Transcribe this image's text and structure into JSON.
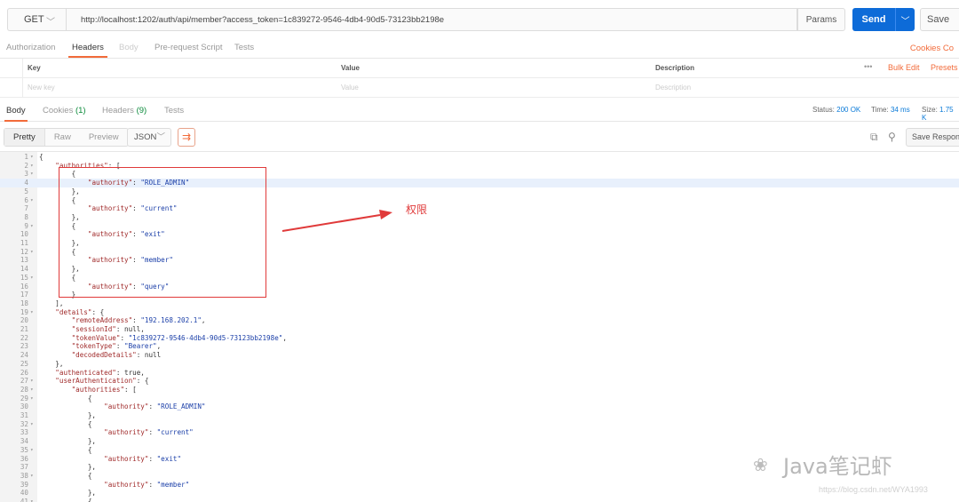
{
  "request": {
    "method": "GET",
    "url": "http://localhost:1202/auth/api/member?access_token=1c839272-9546-4db4-90d5-73123bb2198e",
    "params_label": "Params",
    "send_label": "Send",
    "save_label": "Save"
  },
  "request_tabs": {
    "authorization": "Authorization",
    "headers": "Headers",
    "body": "Body",
    "prerequest": "Pre-request Script",
    "tests": "Tests",
    "cookies": "Cookies  Co"
  },
  "headers_table": {
    "col_key": "Key",
    "col_value": "Value",
    "col_description": "Description",
    "dots": "•••",
    "bulk_edit": "Bulk Edit",
    "presets": "Presets",
    "ph_key": "New key",
    "ph_value": "Value",
    "ph_description": "Description"
  },
  "response_tabs": {
    "body": "Body",
    "cookies": "Cookies",
    "cookies_count": "(1)",
    "headers": "Headers",
    "headers_count": "(9)",
    "tests": "Tests",
    "status_label": "Status:",
    "status_value": "200 OK",
    "time_label": "Time:",
    "time_value": "34 ms",
    "size_label": "Size:",
    "size_value": "1.75 K"
  },
  "viewer": {
    "pretty": "Pretty",
    "raw": "Raw",
    "preview": "Preview",
    "format": "JSON",
    "save_response": "Save Response"
  },
  "code_lines": [
    {
      "n": "1",
      "f": "▾",
      "t": "{"
    },
    {
      "n": "2",
      "f": "▾",
      "t": "    \"authorities\": ["
    },
    {
      "n": "3",
      "f": "▾",
      "t": "        {"
    },
    {
      "n": "4",
      "f": "",
      "t": "            \"authority\": \"ROLE_ADMIN\""
    },
    {
      "n": "5",
      "f": "",
      "t": "        },"
    },
    {
      "n": "6",
      "f": "▾",
      "t": "        {"
    },
    {
      "n": "7",
      "f": "",
      "t": "            \"authority\": \"current\""
    },
    {
      "n": "8",
      "f": "",
      "t": "        },"
    },
    {
      "n": "9",
      "f": "▾",
      "t": "        {"
    },
    {
      "n": "10",
      "f": "",
      "t": "            \"authority\": \"exit\""
    },
    {
      "n": "11",
      "f": "",
      "t": "        },"
    },
    {
      "n": "12",
      "f": "▾",
      "t": "        {"
    },
    {
      "n": "13",
      "f": "",
      "t": "            \"authority\": \"member\""
    },
    {
      "n": "14",
      "f": "",
      "t": "        },"
    },
    {
      "n": "15",
      "f": "▾",
      "t": "        {"
    },
    {
      "n": "16",
      "f": "",
      "t": "            \"authority\": \"query\""
    },
    {
      "n": "17",
      "f": "",
      "t": "        }"
    },
    {
      "n": "18",
      "f": "",
      "t": "    ],"
    },
    {
      "n": "19",
      "f": "▾",
      "t": "    \"details\": {"
    },
    {
      "n": "20",
      "f": "",
      "t": "        \"remoteAddress\": \"192.168.202.1\","
    },
    {
      "n": "21",
      "f": "",
      "t": "        \"sessionId\": null,"
    },
    {
      "n": "22",
      "f": "",
      "t": "        \"tokenValue\": \"1c839272-9546-4db4-90d5-73123bb2198e\","
    },
    {
      "n": "23",
      "f": "",
      "t": "        \"tokenType\": \"Bearer\","
    },
    {
      "n": "24",
      "f": "",
      "t": "        \"decodedDetails\": null"
    },
    {
      "n": "25",
      "f": "",
      "t": "    },"
    },
    {
      "n": "26",
      "f": "",
      "t": "    \"authenticated\": true,"
    },
    {
      "n": "27",
      "f": "▾",
      "t": "    \"userAuthentication\": {"
    },
    {
      "n": "28",
      "f": "▾",
      "t": "        \"authorities\": ["
    },
    {
      "n": "29",
      "f": "▾",
      "t": "            {"
    },
    {
      "n": "30",
      "f": "",
      "t": "                \"authority\": \"ROLE_ADMIN\""
    },
    {
      "n": "31",
      "f": "",
      "t": "            },"
    },
    {
      "n": "32",
      "f": "▾",
      "t": "            {"
    },
    {
      "n": "33",
      "f": "",
      "t": "                \"authority\": \"current\""
    },
    {
      "n": "34",
      "f": "",
      "t": "            },"
    },
    {
      "n": "35",
      "f": "▾",
      "t": "            {"
    },
    {
      "n": "36",
      "f": "",
      "t": "                \"authority\": \"exit\""
    },
    {
      "n": "37",
      "f": "",
      "t": "            },"
    },
    {
      "n": "38",
      "f": "▾",
      "t": "            {"
    },
    {
      "n": "39",
      "f": "",
      "t": "                \"authority\": \"member\""
    },
    {
      "n": "40",
      "f": "",
      "t": "            },"
    },
    {
      "n": "41",
      "f": "▾",
      "t": "            {"
    }
  ],
  "annotation": "权限",
  "watermark": {
    "brand": "Java笔记虾",
    "url": "https://blog.csdn.net/WYA1993"
  },
  "colors": {
    "accent": "#f26b3a",
    "send": "#0d6bd8",
    "annotation": "#e03a3a"
  }
}
